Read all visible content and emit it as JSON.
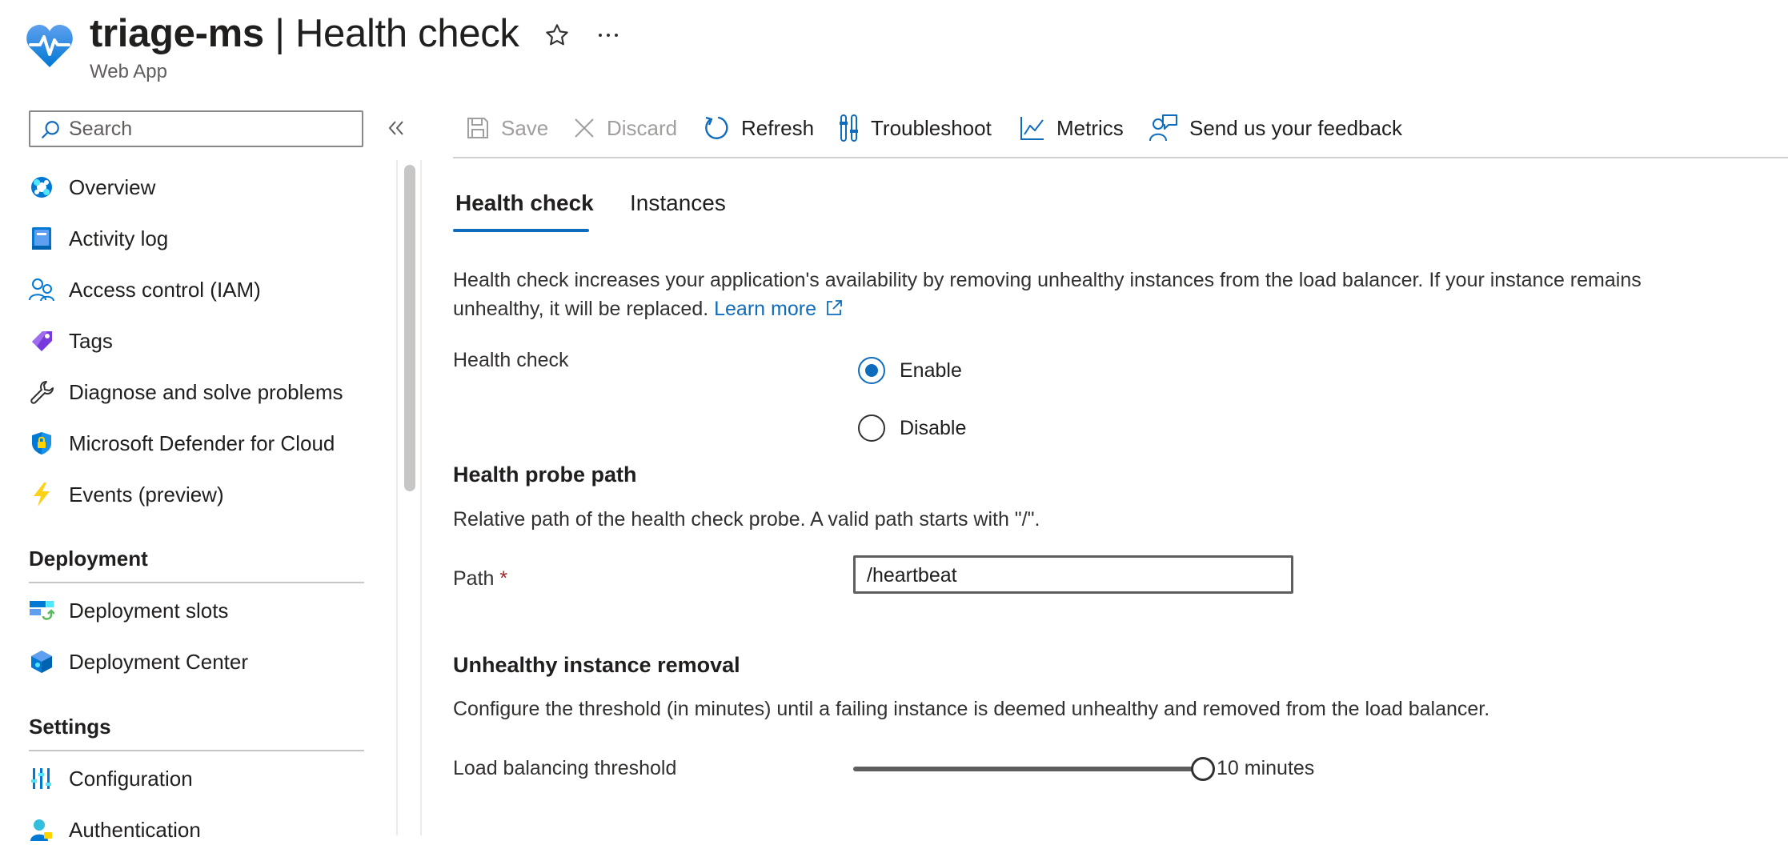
{
  "header": {
    "resource_name": "triage-ms",
    "separator": "|",
    "page_name": "Health check",
    "resource_type": "Web App"
  },
  "sidebar": {
    "search_placeholder": "Search",
    "items": [
      {
        "label": "Overview",
        "icon": "overview-icon"
      },
      {
        "label": "Activity log",
        "icon": "activity-log-icon"
      },
      {
        "label": "Access control (IAM)",
        "icon": "iam-icon"
      },
      {
        "label": "Tags",
        "icon": "tag-icon"
      },
      {
        "label": "Diagnose and solve problems",
        "icon": "wrench-icon"
      },
      {
        "label": "Microsoft Defender for Cloud",
        "icon": "shield-icon"
      },
      {
        "label": "Events (preview)",
        "icon": "lightning-icon"
      }
    ],
    "sections": [
      {
        "title": "Deployment",
        "items": [
          {
            "label": "Deployment slots",
            "icon": "deployment-slots-icon"
          },
          {
            "label": "Deployment Center",
            "icon": "deployment-center-icon"
          }
        ]
      },
      {
        "title": "Settings",
        "items": [
          {
            "label": "Configuration",
            "icon": "configuration-icon"
          },
          {
            "label": "Authentication",
            "icon": "authentication-icon"
          }
        ]
      }
    ]
  },
  "toolbar": {
    "save": "Save",
    "discard": "Discard",
    "refresh": "Refresh",
    "troubleshoot": "Troubleshoot",
    "metrics": "Metrics",
    "feedback": "Send us your feedback"
  },
  "tabs": [
    {
      "label": "Health check",
      "active": true
    },
    {
      "label": "Instances",
      "active": false
    }
  ],
  "content": {
    "description": "Health check increases your application's availability by removing unhealthy instances from the load balancer. If your instance remains unhealthy, it will be replaced.",
    "learn_more": "Learn more",
    "health_check_label": "Health check",
    "enable_label": "Enable",
    "disable_label": "Disable",
    "selected": "Enable",
    "probe_heading": "Health probe path",
    "probe_description": "Relative path of the health check probe. A valid path starts with \"/\".",
    "path_label": "Path",
    "required_mark": "*",
    "path_value": "/heartbeat",
    "removal_heading": "Unhealthy instance removal",
    "removal_description": "Configure the threshold (in minutes) until a failing instance is deemed unhealthy and removed from the load balancer.",
    "threshold_label": "Load balancing threshold",
    "threshold_value": "10 minutes",
    "threshold_level": 1.0
  },
  "colors": {
    "accent": "#0f6cbd",
    "text": "#323130",
    "disabled": "#a19f9d"
  }
}
